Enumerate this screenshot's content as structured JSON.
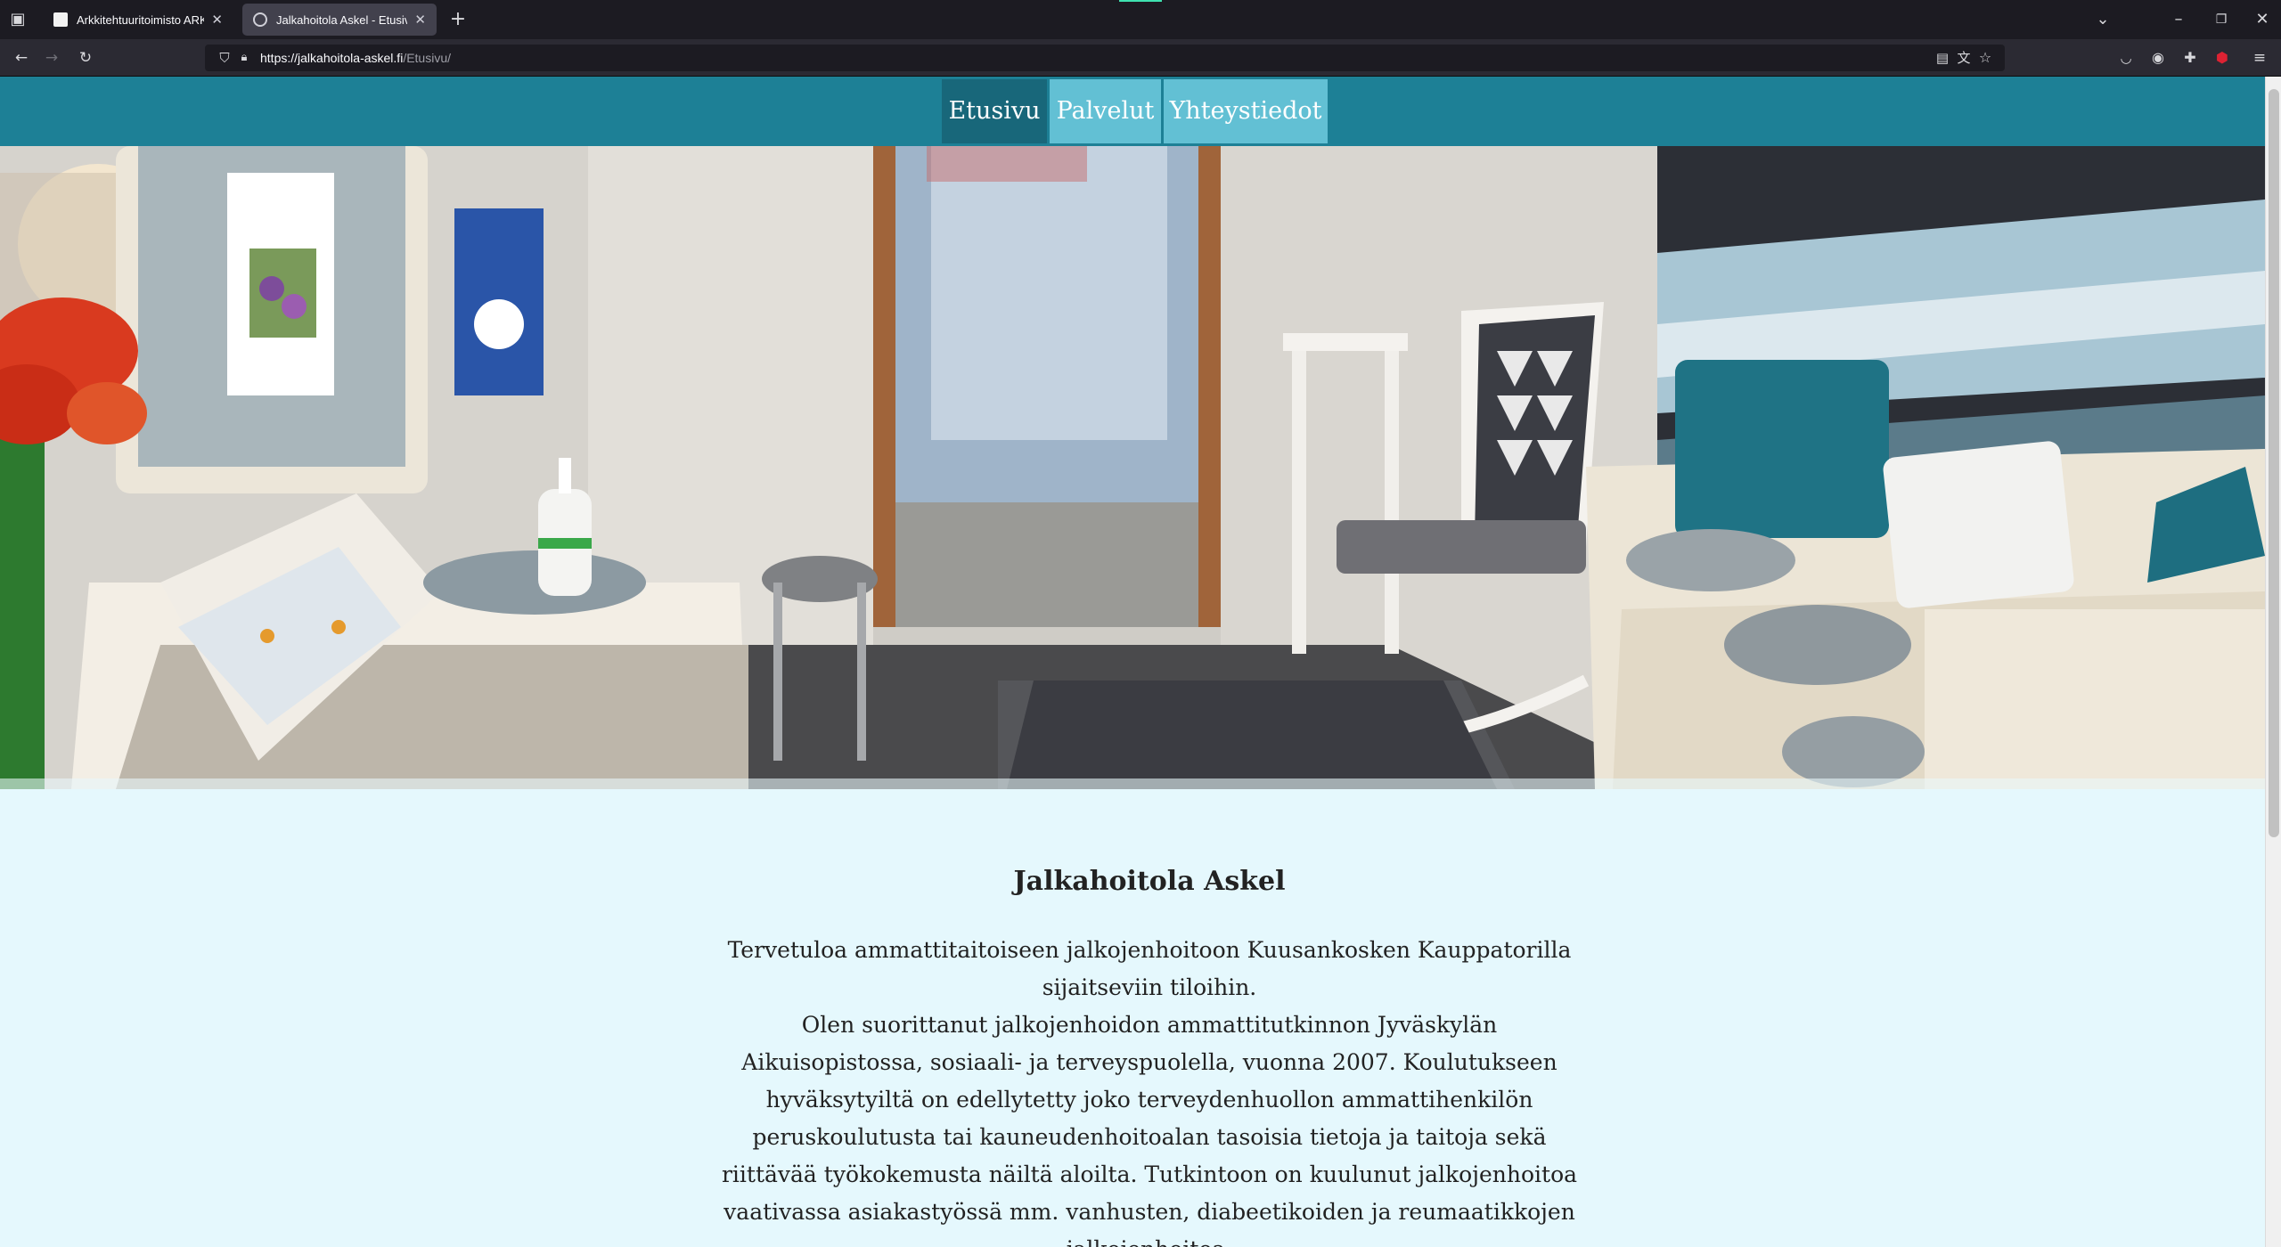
{
  "browser": {
    "tabs": [
      {
        "title": "Arkkitehtuuritoimisto ARKHALTI",
        "close": "✕",
        "active": false
      },
      {
        "title": "Jalkahoitola Askel - Etusivu",
        "close": "✕",
        "active": true
      }
    ],
    "new_tab": "+",
    "url_domain": "https://jalkahoitola-askel.fi",
    "url_path": "/Etusivu/"
  },
  "site": {
    "menu": [
      {
        "label": "Etusivu",
        "active": true
      },
      {
        "label": "Palvelut",
        "active": false
      },
      {
        "label": "Yhteystiedot",
        "active": false
      }
    ],
    "heading": "Jalkahoitola Askel",
    "intro_line1": "Tervetuloa ammattitaitoiseen jalkojenhoitoon Kuusankosken Kauppatorilla sijaitseviin tiloihin.",
    "intro_line2": "Olen suorittanut jalkojenhoidon ammattitutkinnon Jyväskylän Aikuisopistossa, sosiaali- ja terveyspuolella, vuonna 2007. Koulutukseen hyväksytyiltä on edellytetty joko terveydenhuollon ammattihenkilön peruskoulutusta tai kauneudenhoitoalan tasoisia tietoja ja taitoja sekä riittävää työkokemusta näiltä aloilta. Tutkintoon on kuulunut jalkojenhoitoa vaativassa asiakastyössä mm. vanhusten, diabeetikoiden ja reumaatikkojen jalkojenhoitoa."
  },
  "colors": {
    "nav_bg": "#1d8096",
    "menu_active": "#18677a",
    "menu_inactive": "#62c0d4",
    "page_bg": "#e5f8fd"
  }
}
